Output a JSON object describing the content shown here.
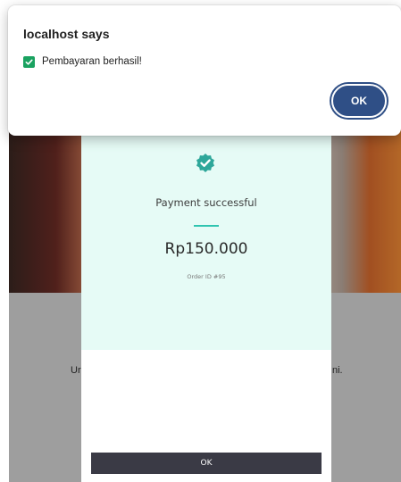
{
  "alert": {
    "title": "localhost says",
    "message": "Pembayaran berhasil!",
    "ok_label": "OK",
    "check_icon": "check-square-icon"
  },
  "modal": {
    "status_text": "Payment successful",
    "amount": "Rp150.000",
    "order_id": "Order ID #95",
    "ok_label": "OK",
    "badge_icon": "verified-check-icon"
  },
  "background": {
    "text_left": "Ur",
    "text_right": "ni."
  },
  "colors": {
    "alert_ok_button": "#2f4f86",
    "success_green": "#1aa260",
    "modal_accent": "#2fc4b0",
    "modal_top_bg": "#e6fbf6",
    "modal_button_bg": "#3a3a45"
  }
}
